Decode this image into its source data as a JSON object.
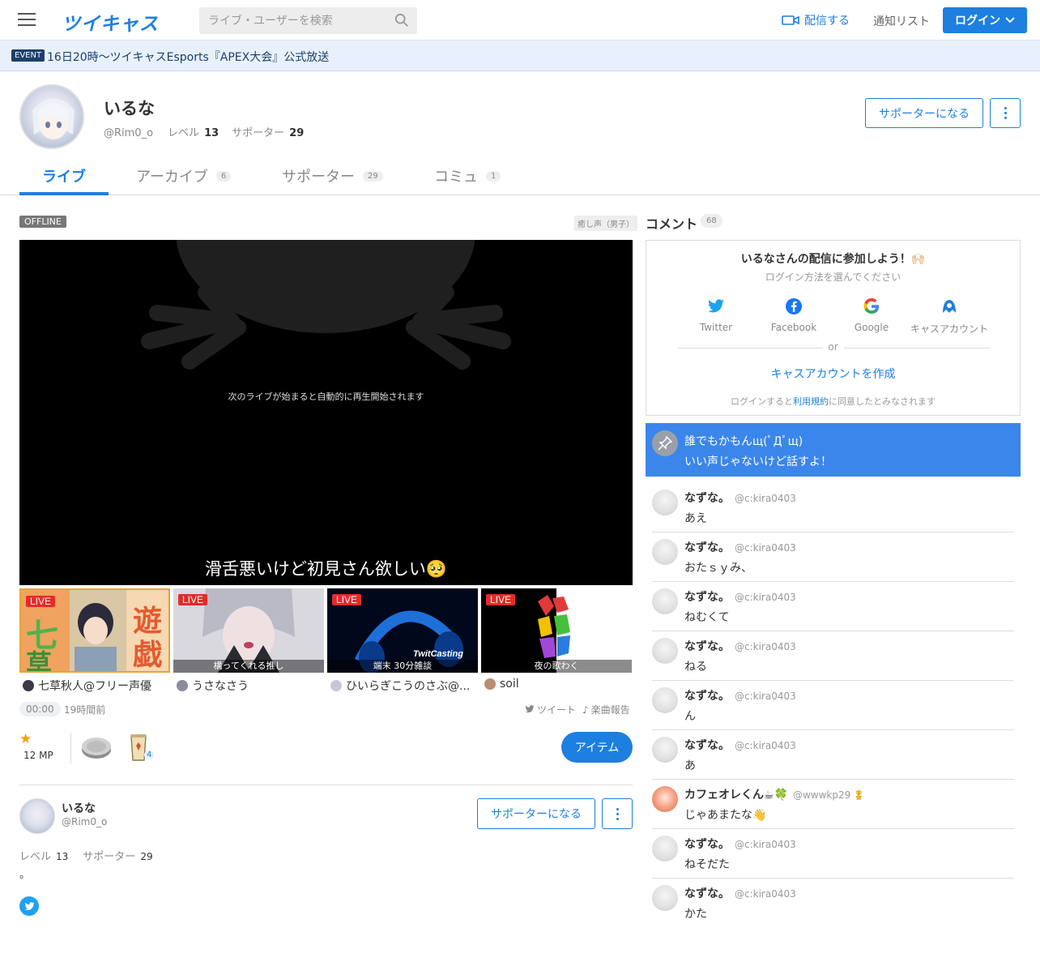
{
  "header": {
    "logo": "ツイキャス",
    "search_placeholder": "ライブ・ユーザーを検索",
    "broadcast": "配信する",
    "notify": "通知リスト",
    "login": "ログイン"
  },
  "event": {
    "badge": "EVENT",
    "text": "16日20時〜ツイキャスEsports『APEX大会』公式放送"
  },
  "profile": {
    "name": "いるな",
    "handle": "@Rim0_o",
    "level_label": "レベル",
    "level": "13",
    "supporter_label": "サポーター",
    "supporters": "29",
    "support_button": "サポーターになる"
  },
  "tabs": [
    {
      "label": "ライブ",
      "count": ""
    },
    {
      "label": "アーカイブ",
      "count": "6"
    },
    {
      "label": "サポーター",
      "count": "29"
    },
    {
      "label": "コミュ",
      "count": "1"
    }
  ],
  "player": {
    "status": "OFFLINE",
    "tag": "癒し声（男子）",
    "message": "次のライブが始まると自動的に再生開始されます",
    "title": "滑舌悪いけど初見さん欲しい🥺"
  },
  "thumbs": [
    {
      "badge": "LIVE",
      "caption": "",
      "name": "七草秋人@フリー声優"
    },
    {
      "badge": "LIVE",
      "caption": "構ってくれる推し",
      "name": "うさなさう"
    },
    {
      "badge": "LIVE",
      "caption": "端末 30分雑談",
      "name": "ひいらぎこうのさぶ@..."
    },
    {
      "badge": "LIVE",
      "caption": "夜の歌わく",
      "name": "soil"
    }
  ],
  "meta": {
    "time": "00:00",
    "ago": "19時間前",
    "tweet": "ツイート",
    "song": "楽曲報告",
    "mp": "12 MP",
    "cup_count": "4",
    "item_button": "アイテム"
  },
  "bio": {
    "name": "いるな",
    "handle": "@Rim0_o",
    "level_label": "レベル",
    "level": "13",
    "supporter_label": "サポーター",
    "supporters": "29",
    "support_button": "サポーターになる",
    "text": "。"
  },
  "comments_panel": {
    "title": "コメント",
    "count": "68",
    "login_title": "いるなさんの配信に参加しよう！🙌🏻",
    "login_sub": "ログイン方法を選んでください",
    "sns": [
      "Twitter",
      "Facebook",
      "Google",
      "キャスアカウント"
    ],
    "or": "or",
    "create": "キャスアカウントを作成",
    "terms_pre": "ログインすると",
    "terms_link": "利用規約",
    "terms_post": "に同意したとみなされます",
    "pinned_line1": "誰でもかもんщ(ﾟДﾟщ)",
    "pinned_line2": "いい声じゃないけど話すよ！"
  },
  "comments": [
    {
      "name": "なずな。",
      "handle": "@c:kira0403",
      "text": "あえ"
    },
    {
      "name": "なずな。",
      "handle": "@c:kira0403",
      "text": "おたｓｙみ、"
    },
    {
      "name": "なずな。",
      "handle": "@c:kira0403",
      "text": "ねむくて"
    },
    {
      "name": "なずな。",
      "handle": "@c:kira0403",
      "text": "ねる"
    },
    {
      "name": "なずな。",
      "handle": "@c:kira0403",
      "text": "ん"
    },
    {
      "name": "なずな。",
      "handle": "@c:kira0403",
      "text": "あ"
    },
    {
      "name": "カフェオレくん☕🍀",
      "handle": "@wwwkp29",
      "text": "じゃあまたな👋"
    },
    {
      "name": "なずな。",
      "handle": "@c:kira0403",
      "text": "ねそだた"
    },
    {
      "name": "なずな。",
      "handle": "@c:kira0403",
      "text": "かた"
    }
  ],
  "colors": {
    "accent": "#1d7fe0",
    "live": "#e52a2a",
    "pinned": "#3b86eb"
  }
}
